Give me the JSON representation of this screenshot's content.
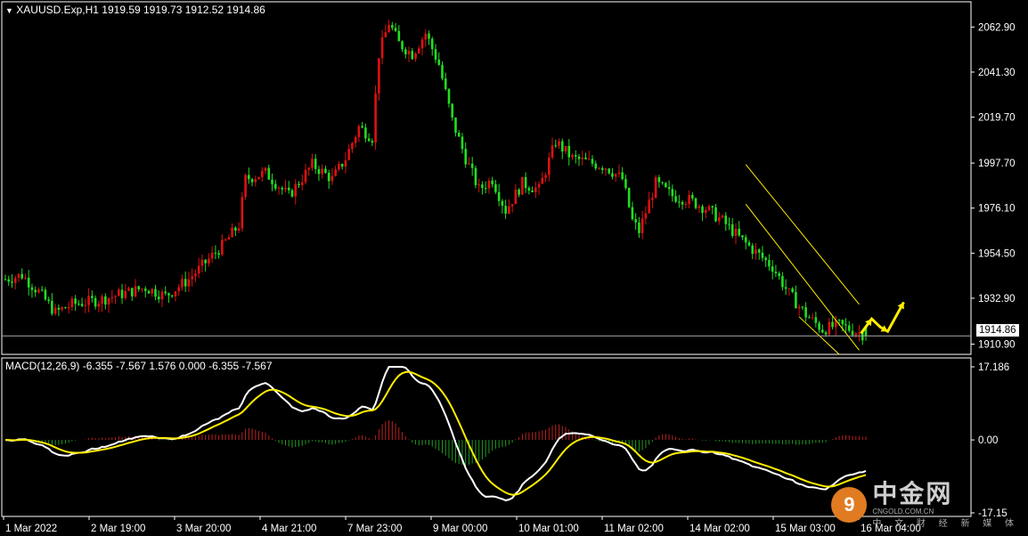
{
  "header": {
    "symbol_line": "XAUUSD.Exp,H1  1919.59 1919.73 1912.52 1914.86",
    "macd_line": "MACD(12,26,9) -6.355 -7.567 1.576 0.000 -6.355 -7.567"
  },
  "current_price_label": "1914.86",
  "colors": {
    "bull": "#dd1111",
    "bear": "#22dd22",
    "macd_line": "#ffffff",
    "signal_line": "#ffee00",
    "hist_pos": "#bb2222",
    "hist_neg": "#229922",
    "channel": "#ffee00",
    "arrows": "#ffee00"
  },
  "watermark": {
    "mark": "9",
    "name": "中金网",
    "sub": "CNGOLD.COM.CN",
    "tag": "中 文 财 经 新 媒 体"
  },
  "chart_data": [
    {
      "type": "candlestick",
      "title": "XAUUSD.Exp,H1",
      "y_ticks": [
        "2062.90",
        "2041.30",
        "2019.70",
        "1997.70",
        "1976.10",
        "1954.50",
        "1932.90",
        "1910.90"
      ],
      "ylim": [
        1906,
        2075
      ],
      "x_ticks": [
        "1 Mar 2022",
        "2 Mar 19:00",
        "3 Mar 20:00",
        "4 Mar 21:00",
        "7 Mar 23:00",
        "9 Mar 00:00",
        "10 Mar 01:00",
        "11 Mar 02:00",
        "14 Mar 02:00",
        "15 Mar 03:00",
        "16 Mar 04:00"
      ],
      "last": {
        "open": 1919.59,
        "high": 1919.73,
        "low": 1912.52,
        "close": 1914.86
      },
      "anchors": [
        [
          0,
          1942
        ],
        [
          5,
          1944
        ],
        [
          10,
          1936
        ],
        [
          15,
          1926
        ],
        [
          20,
          1930
        ],
        [
          28,
          1932
        ],
        [
          35,
          1935
        ],
        [
          42,
          1938
        ],
        [
          48,
          1934
        ],
        [
          55,
          1942
        ],
        [
          60,
          1950
        ],
        [
          65,
          1958
        ],
        [
          70,
          1968
        ],
        [
          72,
          1990
        ],
        [
          78,
          1993
        ],
        [
          85,
          1982
        ],
        [
          92,
          1997
        ],
        [
          98,
          1990
        ],
        [
          102,
          2000
        ],
        [
          106,
          2015
        ],
        [
          110,
          2010
        ],
        [
          112,
          2050
        ],
        [
          115,
          2065
        ],
        [
          118,
          2055
        ],
        [
          122,
          2050
        ],
        [
          126,
          2060
        ],
        [
          130,
          2045
        ],
        [
          134,
          2018
        ],
        [
          138,
          2000
        ],
        [
          142,
          1985
        ],
        [
          146,
          1990
        ],
        [
          150,
          1975
        ],
        [
          155,
          1988
        ],
        [
          160,
          1985
        ],
        [
          165,
          2008
        ],
        [
          170,
          2000
        ],
        [
          175,
          1998
        ],
        [
          180,
          1996
        ],
        [
          185,
          1990
        ],
        [
          188,
          1970
        ],
        [
          190,
          1965
        ],
        [
          195,
          1988
        ],
        [
          200,
          1982
        ],
        [
          205,
          1980
        ],
        [
          210,
          1976
        ],
        [
          215,
          1970
        ],
        [
          220,
          1962
        ],
        [
          225,
          1955
        ],
        [
          230,
          1948
        ],
        [
          235,
          1935
        ],
        [
          240,
          1925
        ],
        [
          245,
          1918
        ],
        [
          250,
          1920
        ],
        [
          255,
          1917
        ],
        [
          258,
          1915
        ]
      ],
      "annotation": "descending channel with projected rebound arrows"
    },
    {
      "type": "macd",
      "params": "12,26,9",
      "values": {
        "macd": -6.355,
        "signal": -7.567,
        "hist": 1.576
      },
      "y_ticks": [
        "17.186",
        "0.00",
        "-17.15"
      ],
      "ylim": [
        -17.15,
        17.186
      ]
    }
  ]
}
